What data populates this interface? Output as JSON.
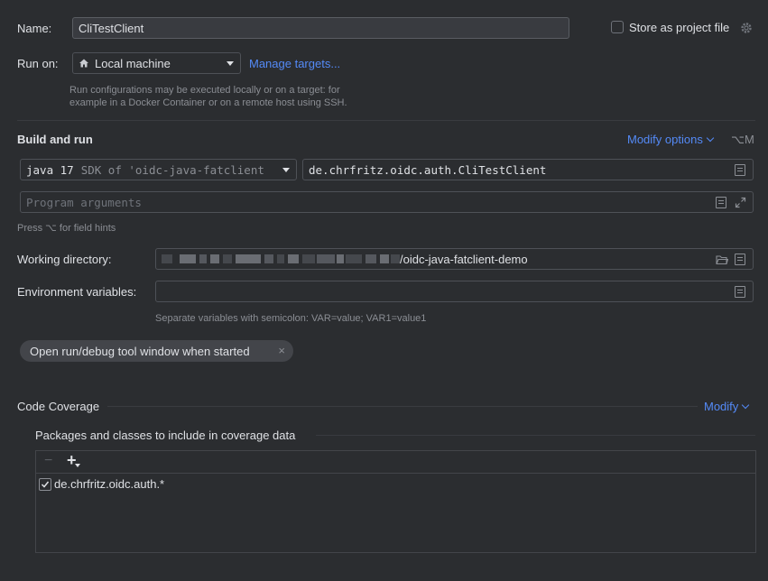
{
  "name": {
    "label": "Name:",
    "value": "CliTestClient"
  },
  "store_project": {
    "label": "Store as project file",
    "checked": false
  },
  "run_on": {
    "label": "Run on:",
    "value": "Local machine",
    "manage_link": "Manage targets...",
    "hint_line1": "Run configurations may be executed locally or on a target: for",
    "hint_line2": "example in a Docker Container or on a remote host using SSH."
  },
  "build_run": {
    "title": "Build and run",
    "modify_options": "Modify options",
    "shortcut": "⌥M",
    "sdk_java": "java 17",
    "sdk_desc": "SDK of 'oidc-java-fatclient",
    "main_class": "de.chrfritz.oidc.auth.CliTestClient",
    "program_args_placeholder": "Program arguments",
    "field_hint": "Press ⌥ for field hints"
  },
  "working_dir": {
    "label": "Working directory:",
    "value_suffix": "/oidc-java-fatclient-demo"
  },
  "env_vars": {
    "label": "Environment variables:",
    "value": "",
    "hint": "Separate variables with semicolon: VAR=value; VAR1=value1"
  },
  "tag": {
    "label": "Open run/debug tool window when started",
    "close": "×"
  },
  "coverage": {
    "title": "Code Coverage",
    "modify": "Modify",
    "packages_title": "Packages and classes to include in coverage data",
    "toolbar": {
      "remove": "−",
      "add": "+"
    },
    "items": [
      {
        "label": "de.chrfritz.oidc.auth.*",
        "checked": true
      }
    ]
  },
  "colors": {
    "background": "#2b2d30",
    "accent_link": "#548af7",
    "border": "#4e5157",
    "text": "#dfe1e5",
    "hint": "#8b8e94"
  }
}
